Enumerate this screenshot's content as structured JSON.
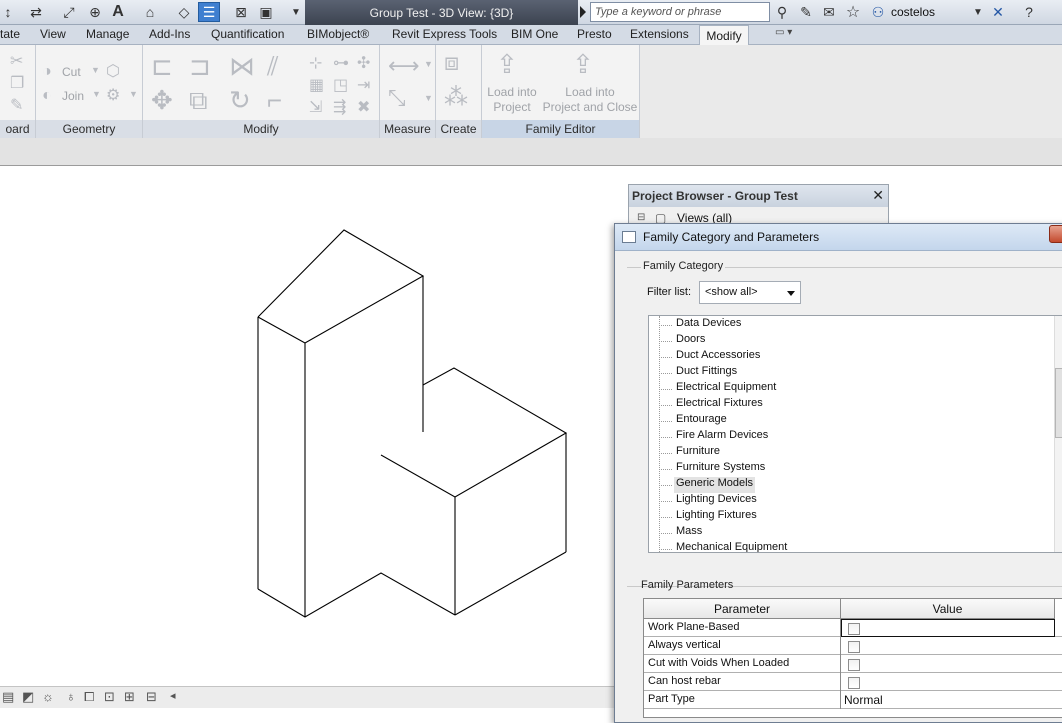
{
  "window": {
    "title": "Group Test - 3D View: {3D}"
  },
  "search": {
    "placeholder": "Type a keyword or phrase"
  },
  "user": {
    "name": "costelos"
  },
  "ribbon": {
    "tabs": [
      "tate",
      "View",
      "Manage",
      "Add-Ins",
      "Quantification",
      "BIMobject®",
      "Revit Express Tools",
      "BIM One",
      "Presto",
      "Extensions",
      "Modify"
    ],
    "active_tab": "Modify",
    "panels": {
      "clipboard": "oard",
      "geometry": "Geometry",
      "modify": "Modify",
      "measure": "Measure",
      "create": "Create",
      "family_editor": "Family Editor"
    },
    "buttons": {
      "cut": "Cut",
      "join": "Join",
      "load_into_project": [
        "Load into",
        "Project"
      ],
      "load_into_project_close": [
        "Load into",
        "Project and Close"
      ]
    }
  },
  "project_browser": {
    "title": "Project Browser - Group Test",
    "item": "Views (all)"
  },
  "dialog": {
    "title": "Family Category and Parameters",
    "family_category_label": "Family Category",
    "filter_label": "Filter list:",
    "filter_value": "<show all>",
    "categories": [
      "Data Devices",
      "Doors",
      "Duct Accessories",
      "Duct Fittings",
      "Electrical Equipment",
      "Electrical Fixtures",
      "Entourage",
      "Fire Alarm Devices",
      "Furniture",
      "Furniture Systems",
      "Generic Models",
      "Lighting Devices",
      "Lighting Fixtures",
      "Mass",
      "Mechanical Equipment"
    ],
    "selected_category": "Generic Models",
    "family_parameters_label": "Family Parameters",
    "columns": {
      "parameter": "Parameter",
      "value": "Value"
    },
    "parameters": [
      {
        "name": "Work Plane-Based",
        "type": "checkbox",
        "checked": false
      },
      {
        "name": "Always vertical",
        "type": "checkbox",
        "checked": false
      },
      {
        "name": "Cut with Voids When Loaded",
        "type": "checkbox",
        "checked": false
      },
      {
        "name": "Can host rebar",
        "type": "checkbox",
        "checked": false
      },
      {
        "name": "Part Type",
        "type": "text",
        "value": "Normal"
      }
    ]
  }
}
